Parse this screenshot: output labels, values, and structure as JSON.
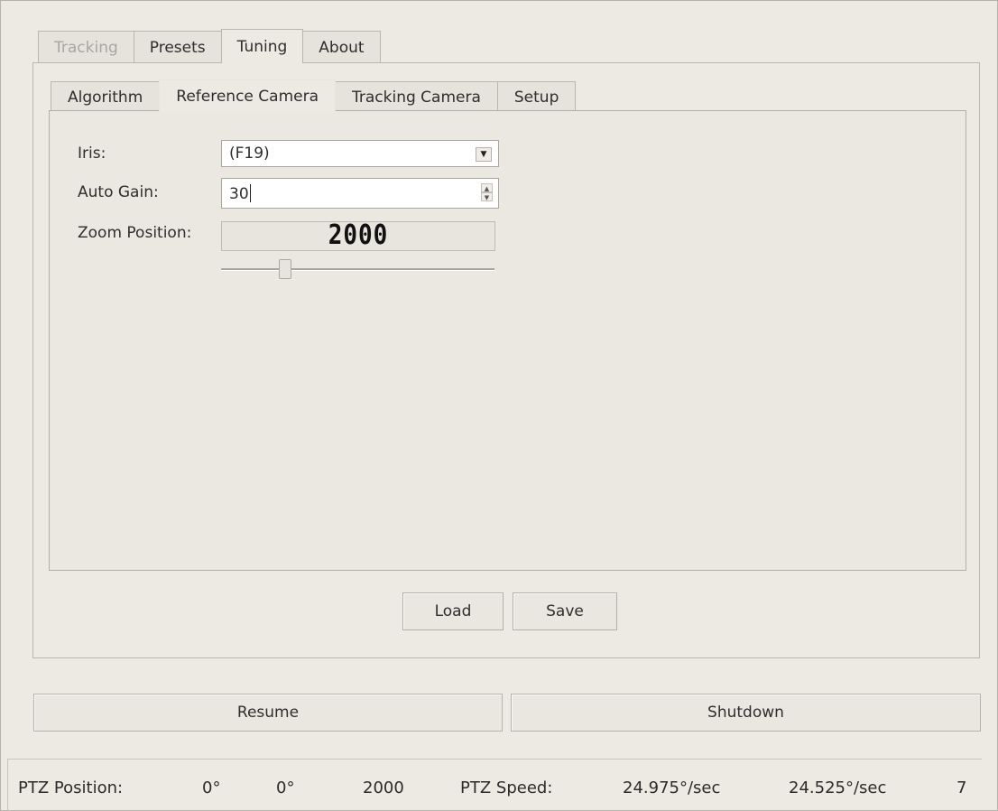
{
  "outer_tabs": [
    {
      "label": "Tracking",
      "state": "disabled"
    },
    {
      "label": "Presets",
      "state": "normal"
    },
    {
      "label": "Tuning",
      "state": "active"
    },
    {
      "label": "About",
      "state": "normal"
    }
  ],
  "inner_tabs": [
    {
      "label": "Algorithm",
      "state": "normal"
    },
    {
      "label": "Reference Camera",
      "state": "active"
    },
    {
      "label": "Tracking Camera",
      "state": "normal"
    },
    {
      "label": "Setup",
      "state": "normal"
    }
  ],
  "form": {
    "iris_label": "Iris:",
    "iris_value": "(F19)",
    "auto_gain_label": "Auto Gain:",
    "auto_gain_value": "30",
    "zoom_label": "Zoom Position:",
    "zoom_value": "2000",
    "zoom_slider_fraction": 0.22
  },
  "pane_buttons": {
    "load": "Load",
    "save": "Save"
  },
  "main_buttons": {
    "resume": "Resume",
    "shutdown": "Shutdown"
  },
  "status": {
    "ptz_position_label": "PTZ Position:",
    "pan": "0°",
    "tilt": "0°",
    "zoom": "2000",
    "ptz_speed_label": "PTZ Speed:",
    "pan_speed": "24.975°/sec",
    "tilt_speed": "24.525°/sec",
    "extra": "7"
  },
  "colors": {
    "background": "#ede9e3",
    "border": "#b9b5af",
    "field": "#ffffff"
  }
}
